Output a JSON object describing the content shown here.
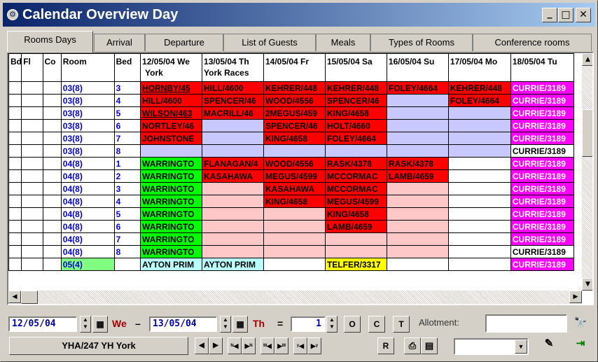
{
  "window": {
    "title": "Calendar Overview Day",
    "minimize": "_",
    "maximize": "□",
    "close": "✕",
    "icon": "app-icon"
  },
  "tabs": [
    "Rooms Days",
    "Arrival",
    "Departure",
    "List of Guests",
    "Meals",
    "Types of Rooms",
    "Conference rooms"
  ],
  "grid": {
    "headers": {
      "bd": "Bd",
      "fl": "Fl",
      "co": "Co",
      "room": "Room",
      "bed": "Bed",
      "d1": "12/05/04 We",
      "d1b": "York",
      "d2": "13/05/04 Th",
      "d2b": "York Races",
      "d3": "14/05/04 Fr",
      "d4": "15/05/04 Sa",
      "d5": "16/05/04 Su",
      "d6": "17/05/04 Mo",
      "d7": "18/05/04 Tu"
    },
    "rows": [
      {
        "room": "03(8)",
        "bed": "3",
        "d1": "HORNBY/45",
        "d2": "HILL/4600",
        "d3": "KEHRER/448",
        "d4": "KEHRER/448",
        "d5": "FOLEY/4664",
        "d6": "KEHRER/448",
        "d7": "CURRIE/3189"
      },
      {
        "room": "03(8)",
        "bed": "4",
        "d1": "HILL/4600",
        "d2": "SPENCER/46",
        "d3": "WOOD/4556",
        "d4": "SPENCER/46",
        "d5": "",
        "d6": "FOLEY/4664",
        "d7": "CURRIE/3189"
      },
      {
        "room": "03(8)",
        "bed": "5",
        "d1": "WILSON/463",
        "d2": "MACRILL/46",
        "d3": "2MEGUS/459",
        "d4": "KING/4658",
        "d5": "",
        "d6": "",
        "d7": "CURRIE/3189"
      },
      {
        "room": "03(8)",
        "bed": "6",
        "d1": "NORTLEY/46",
        "d2": "",
        "d3": "SPENCER/46",
        "d4": "HOLT/4660",
        "d5": "",
        "d6": "",
        "d7": "CURRIE/3189"
      },
      {
        "room": "03(8)",
        "bed": "7",
        "d1": "JOHNSTONE",
        "d2": "",
        "d3": "KING/4658",
        "d4": "FOLEY/4664",
        "d5": "",
        "d6": "",
        "d7": "CURRIE/3189"
      },
      {
        "room": "03(8)",
        "bed": "8",
        "d1": "",
        "d2": "",
        "d3": "",
        "d4": "",
        "d5": "",
        "d6": "",
        "d7": "CURRIE/3189"
      },
      {
        "room": "04(8)",
        "bed": "1",
        "d1": "WARRINGTO",
        "d2": "FLANAGAN/4",
        "d3": "WOOD/4556",
        "d4": "RASK/4378",
        "d5": "RASK/4378",
        "d6": "",
        "d7": "CURRIE/3189"
      },
      {
        "room": "04(8)",
        "bed": "2",
        "d1": "WARRINGTO",
        "d2": "KASAHAWA",
        "d3": "MEGUS/4599",
        "d4": "MCCORMAC",
        "d5": "LAMB/4659",
        "d6": "",
        "d7": "CURRIE/3189"
      },
      {
        "room": "04(8)",
        "bed": "3",
        "d1": "WARRINGTO",
        "d2": "",
        "d3": "KASAHAWA",
        "d4": "MCCORMAC",
        "d5": "",
        "d6": "",
        "d7": "CURRIE/3189"
      },
      {
        "room": "04(8)",
        "bed": "4",
        "d1": "WARRINGTO",
        "d2": "",
        "d3": "KING/4658",
        "d4": "MEGUS/4599",
        "d5": "",
        "d6": "",
        "d7": "CURRIE/3189"
      },
      {
        "room": "04(8)",
        "bed": "5",
        "d1": "WARRINGTO",
        "d2": "",
        "d3": "",
        "d4": "KING/4658",
        "d5": "",
        "d6": "",
        "d7": "CURRIE/3189"
      },
      {
        "room": "04(8)",
        "bed": "6",
        "d1": "WARRINGTO",
        "d2": "",
        "d3": "",
        "d4": "LAMB/4659",
        "d5": "",
        "d6": "",
        "d7": "CURRIE/3189"
      },
      {
        "room": "04(8)",
        "bed": "7",
        "d1": "WARRINGTO",
        "d2": "",
        "d3": "",
        "d4": "",
        "d5": "",
        "d6": "",
        "d7": "CURRIE/3189"
      },
      {
        "room": "04(8)",
        "bed": "8",
        "d1": "WARRINGTO",
        "d2": "",
        "d3": "",
        "d4": "",
        "d5": "",
        "d6": "",
        "d7": "CURRIE/3189"
      },
      {
        "room": "05(4)",
        "bed": "",
        "d1": "AYTON PRIM",
        "d2": "AYTON PRIM",
        "d3": "",
        "d4": "TELFER/3317",
        "d5": "",
        "d6": "",
        "d7": "CURRIE/3189"
      }
    ]
  },
  "controls": {
    "date_from": "12/05/04",
    "day_from": "We",
    "dash": "–",
    "date_to": "13/05/04",
    "day_to": "Th",
    "equals": "=",
    "count": "1",
    "btn_o": "O",
    "btn_c": "C",
    "btn_t": "T",
    "allotment_label": "Allotment:",
    "allotment_value": "",
    "hostel": "YHA/247 YH York",
    "btn_r": "R",
    "select_value": ""
  },
  "colors": {
    "red": "#ff0000",
    "green": "#00ff00",
    "lavender": "#c8c8ff",
    "pink": "#ffc8c8",
    "magenta": "#ff00ff",
    "cyan": "#b8ffff",
    "yellow": "#ffff00"
  }
}
